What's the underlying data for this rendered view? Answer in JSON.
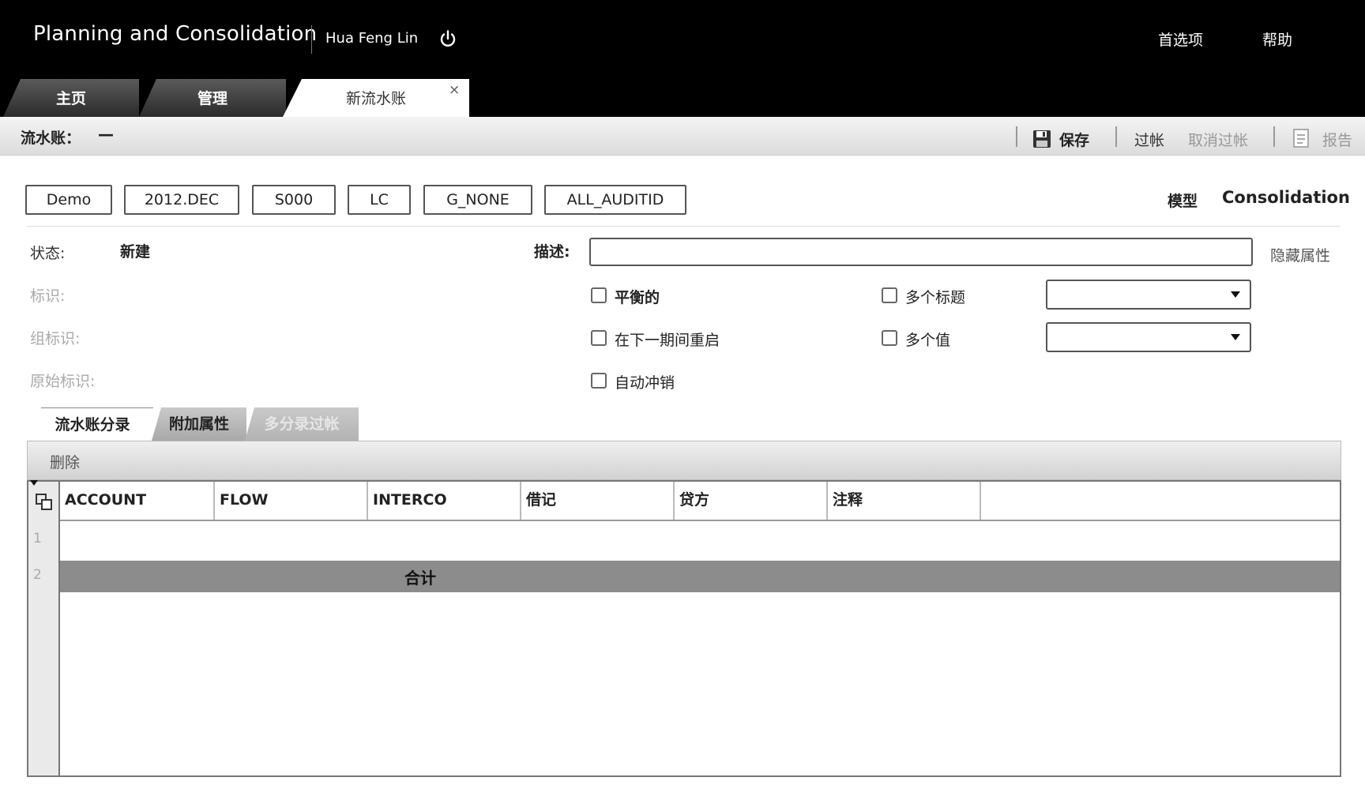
{
  "header": {
    "app_title": "Planning and Consolidation",
    "user_name": "Hua Feng Lin",
    "preferences": "首选项",
    "help": "帮助"
  },
  "tabs": [
    {
      "label": "主页"
    },
    {
      "label": "管理"
    },
    {
      "label": "新流水账",
      "close": "×"
    }
  ],
  "toolbar": {
    "journal_label": "流水账：",
    "journal_value": "—",
    "save": "保存",
    "post": "过帐",
    "unpost": "取消过帐",
    "report": "报告"
  },
  "dimensions": [
    "Demo",
    "2012.DEC",
    "S000",
    "LC",
    "G_NONE",
    "ALL_AUDITID"
  ],
  "model": {
    "label": "模型",
    "value": "Consolidation"
  },
  "form": {
    "status_label": "状态:",
    "status_value": "新建",
    "id_label": "标识:",
    "group_id_label": "组标识:",
    "original_id_label": "原始标识:",
    "description_label": "描述:",
    "description_value": "",
    "hide_properties": "隐藏属性",
    "balanced": "平衡的",
    "reopen_next_period": "在下一期间重启",
    "auto_reverse": "自动冲销",
    "multiple_headers": "多个标题",
    "multiple_values": "多个值"
  },
  "subtabs": [
    "流水账分录",
    "附加属性",
    "多分录过帐"
  ],
  "grid": {
    "delete": "删除",
    "columns": [
      "ACCOUNT",
      "FLOW",
      "INTERCO",
      "借记",
      "贷方",
      "注释"
    ],
    "row_numbers": [
      "1",
      "2"
    ],
    "total_label": "合计"
  }
}
